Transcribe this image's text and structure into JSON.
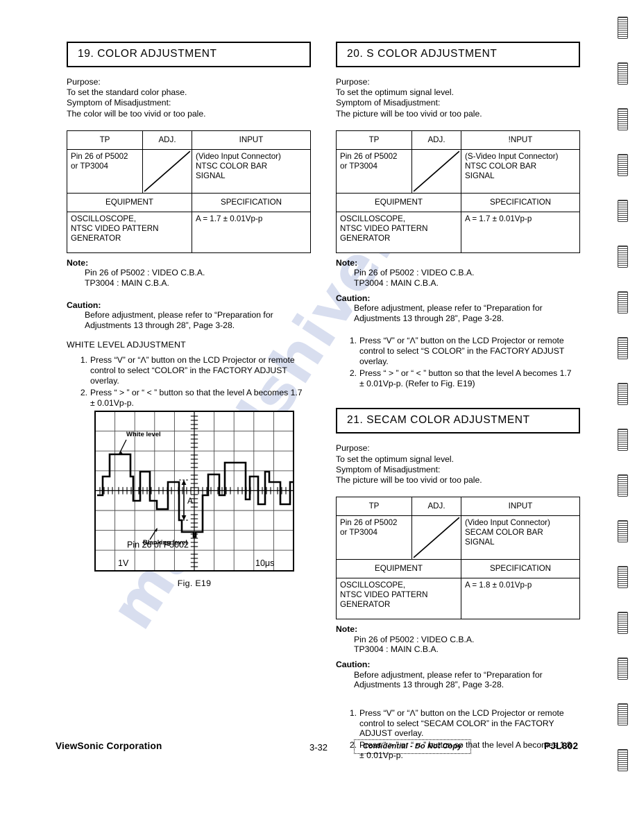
{
  "watermark": {
    "text": "manualshive.c"
  },
  "sections": [
    {
      "id": "color-adjustment",
      "title": "19.  COLOR ADJUSTMENT",
      "purpose": [
        "Purpose:",
        "To set the standard color phase.",
        "Symptom of Misadjustment:",
        "The color will be too vivid or too pale."
      ],
      "table": {
        "headers": {
          "tp": "TP",
          "adj": "ADJ.",
          "input": "INPUT"
        },
        "tp_value": [
          "Pin 26 of P5002",
          "or TP3004"
        ],
        "adj_value": "",
        "input_value": [
          "(Video Input Connector)",
          "NTSC COLOR BAR",
          "SIGNAL"
        ],
        "headers2": {
          "equipment": "EQUIPMENT",
          "specification": "SPECIFICATION"
        },
        "equipment_value": [
          "OSCILLOSCOPE,",
          "NTSC VIDEO PATTERN",
          "GENERATOR"
        ],
        "specification_value": "A = 1.7 ± 0.01Vp-p"
      },
      "note": {
        "label": "Note:",
        "lines": [
          "Pin 26 of P5002 : VIDEO C.B.A.",
          "TP3004 : MAIN C.B.A."
        ]
      },
      "caution": {
        "label": "Caution:",
        "lines": [
          "Before adjustment, please refer to “Preparation for",
          "Adjustments 13 through 28”, Page 3-28."
        ]
      },
      "subhead": "WHITE LEVEL ADJUSTMENT",
      "steps": [
        {
          "num": "1.",
          "lines": [
            "Press “V” or “Λ” button on the LCD Projector or remote",
            "control to select “COLOR” in the FACTORY ADJUST",
            "overlay."
          ]
        },
        {
          "num": "2.",
          "lines": [
            "Press “ > ” or “ < ” button so that the level A becomes 1.7",
            "± 0.01Vp-p."
          ]
        }
      ]
    },
    {
      "id": "s-color-adjustment",
      "title": "20.  S COLOR ADJUSTMENT",
      "purpose": [
        "Purpose:",
        "To set the optimum signal level.",
        "Symptom of Misadjustment:",
        "The picture will be too vivid or too pale."
      ],
      "table": {
        "headers": {
          "tp": "TP",
          "adj": "ADJ.",
          "input": "!NPUT"
        },
        "tp_value": [
          "Pin 26 of P5002",
          "or TP3004"
        ],
        "adj_value": "",
        "input_value": [
          "(S-Video Input Connector)",
          "NTSC COLOR BAR",
          "SIGNAL"
        ],
        "headers2": {
          "equipment": "EQUIPMENT",
          "specification": "SPECIFICATION"
        },
        "equipment_value": [
          "OSCILLOSCOPE,",
          "NTSC VIDEO PATTERN",
          "GENERATOR"
        ],
        "specification_value": "A = 1.7 ± 0.01Vp-p"
      },
      "note": {
        "label": "Note:",
        "lines": [
          "Pin 26 of P5002 : VIDEO C.B.A.",
          "TP3004 : MAIN C.B.A."
        ]
      },
      "caution": {
        "label": "Caution:",
        "lines": [
          "Before adjustment, please refer to “Preparation for",
          "Adjustments 13 through 28”, Page 3-28."
        ]
      },
      "subhead": "",
      "steps": [
        {
          "num": "1.",
          "lines": [
            "Press “V” or “Λ” button on the LCD Projector or remote",
            "control to select “S COLOR” in the FACTORY ADJUST",
            "overlay."
          ]
        },
        {
          "num": "2.",
          "lines": [
            "Press “ > ” or “ < ” button so that the level A becomes 1.7",
            "± 0.01Vp-p. (Refer to Fig. E19)"
          ]
        }
      ]
    },
    {
      "id": "secam-color-adjustment",
      "title": "21. SECAM COLOR ADJUSTMENT",
      "purpose": [
        "Purpose:",
        "To set the optimum signal level.",
        "Symptom of Misadjustment:",
        "The picture will be too vivid or too pale."
      ],
      "table": {
        "headers": {
          "tp": "TP",
          "adj": "ADJ.",
          "input": "INPUT"
        },
        "tp_value": [
          "Pin 26 of P5002",
          "or TP3004"
        ],
        "adj_value": "",
        "input_value": [
          "(Video Input Connector)",
          "SECAM COLOR BAR",
          "SIGNAL"
        ],
        "headers2": {
          "equipment": "EQUIPMENT",
          "specification": "SPECIFICATION"
        },
        "equipment_value": [
          "OSCILLOSCOPE,",
          "NTSC VIDEO PATTERN",
          "GENERATOR"
        ],
        "specification_value": "A = 1.8 ± 0.01Vp-p"
      },
      "note": {
        "label": "Note:",
        "lines": [
          "Pin 26 of P5002 : VIDEO C.B.A.",
          "TP3004 : MAIN C.B.A."
        ]
      },
      "caution": {
        "label": "Caution:",
        "lines": [
          "Before adjustment, please refer to “Preparation for",
          "Adjustments 13 through 28”, Page 3-28."
        ]
      },
      "subhead": "",
      "steps": [
        {
          "num": "1.",
          "lines": [
            "Press “V” or “Λ” button on the LCD Projector or remote",
            "control to select “SECAM COLOR” in the FACTORY",
            "ADJUST overlay."
          ]
        },
        {
          "num": "2.",
          "lines": [
            "Press “ > ” or “ < ” button so that the level A becomes 1.8",
            "± 0.01Vp-p."
          ]
        }
      ]
    }
  ],
  "figure": {
    "caption": "Fig. E19",
    "labels": {
      "white_level": "White level",
      "blanking_level": "Blanking level",
      "amplitude": "A",
      "testpoint": "Pin 26 of P5002",
      "volts_per_div": "1V",
      "time_per_div": "10μs"
    },
    "grid": {
      "cols": 10,
      "rows": 8
    }
  },
  "footer": {
    "company": "ViewSonic Corporation",
    "page_number": "3-32",
    "confidential": "Confidential  -  Do Not Copy",
    "model": "PJL802"
  },
  "edge_marks": {
    "count": 17
  }
}
